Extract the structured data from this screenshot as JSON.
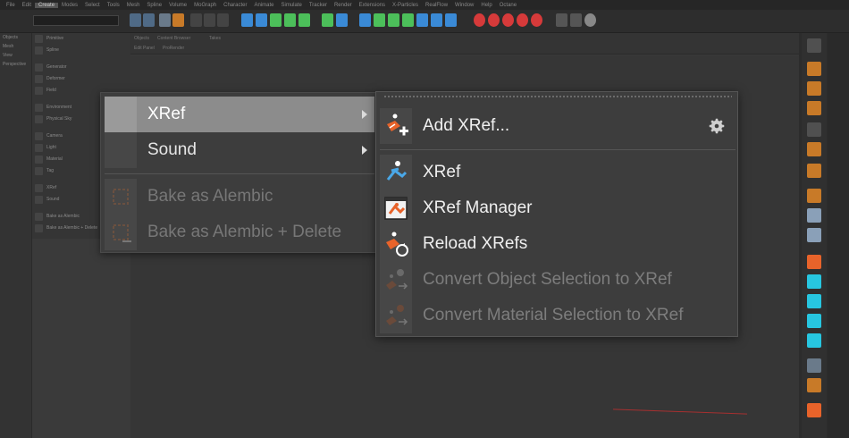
{
  "menubar": {
    "items": [
      "File",
      "Edit",
      "Create",
      "Modes",
      "Select",
      "Tools",
      "Mesh",
      "Spline",
      "Volume",
      "MoGraph",
      "Character",
      "Animate",
      "Simulate",
      "Tracker",
      "Render",
      "Extensions",
      "X-Particles",
      "RealFlow",
      "Window",
      "Help",
      "Octane"
    ]
  },
  "left_panel": {
    "labels": [
      "Objects",
      "Mesh",
      "View",
      "Perspective"
    ]
  },
  "create_list": {
    "items": [
      "Primitive",
      "Spline",
      "Generator",
      "Deformer",
      "Field",
      "Environment",
      "Physical Sky",
      "Camera",
      "Light",
      "Material",
      "Tag",
      "XRef",
      "Sound",
      "Bake as Alembic",
      "Bake as Alembic + Delete"
    ]
  },
  "viewport_header": {
    "tabs": [
      "Objects",
      "Content Browser",
      "Takes"
    ],
    "menu": [
      "Edit",
      "Panel",
      "ProRender"
    ]
  },
  "menu_primary": {
    "items": [
      {
        "label": "XRef",
        "submenu": true,
        "highlighted": true,
        "disabled": false
      },
      {
        "label": "Sound",
        "submenu": true,
        "highlighted": false,
        "disabled": false
      },
      {
        "label": "Bake as Alembic",
        "submenu": false,
        "highlighted": false,
        "disabled": true
      },
      {
        "label": "Bake as Alembic + Delete",
        "submenu": false,
        "highlighted": false,
        "disabled": true
      }
    ]
  },
  "menu_xref": {
    "items": [
      {
        "label": "Add XRef...",
        "icon": "add-xref-icon",
        "disabled": false
      },
      {
        "label": "XRef",
        "icon": "xref-icon",
        "disabled": false
      },
      {
        "label": "XRef Manager",
        "icon": "xref-manager-icon",
        "disabled": false
      },
      {
        "label": "Reload XRefs",
        "icon": "reload-xrefs-icon",
        "disabled": false
      },
      {
        "label": "Convert Object Selection to XRef",
        "icon": "convert-object-icon",
        "disabled": true
      },
      {
        "label": "Convert Material Selection to XRef",
        "icon": "convert-material-icon",
        "disabled": true
      }
    ],
    "settings_icon": "gear-icon"
  },
  "colors": {
    "accent_orange": "#e8632a",
    "accent_blue": "#4aa8e8",
    "highlight": "#8c8c8c",
    "menu_bg": "#3d3d3d"
  }
}
